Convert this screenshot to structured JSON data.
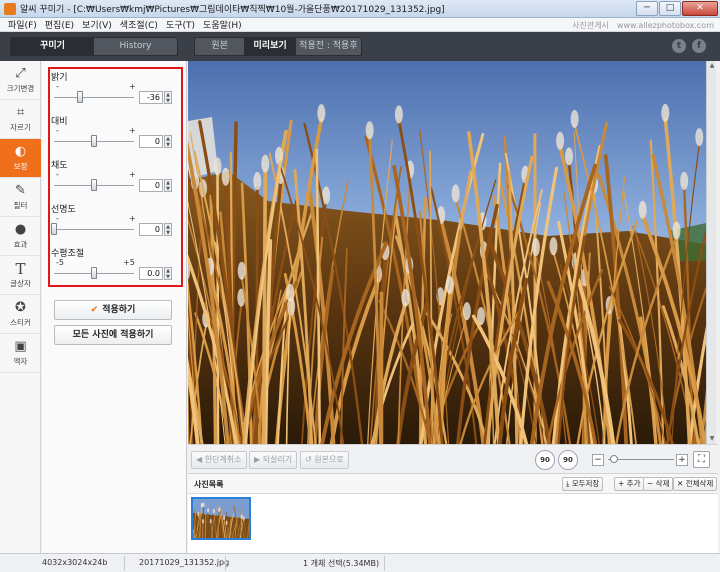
{
  "window": {
    "title": "알씨 꾸미기 - [C:₩Users₩kmj₩Pictures₩그림데이타₩직찍₩10월-가을단풍₩20171029_131352.jpg]",
    "btn_min": "─",
    "btn_max": "□",
    "btn_close": "✕"
  },
  "menu": {
    "items": [
      "파일(F)",
      "편집(E)",
      "보기(V)",
      "색조절(C)",
      "도구(T)",
      "도움말(H)"
    ],
    "right_1": "사진관게시",
    "right_2": "www.allezphotobox.com"
  },
  "topbar": {
    "tab_decorate": "꾸미기",
    "tab_history": "History",
    "view_original": "원본",
    "view_preview": "미리보기",
    "view_before_after": "적용전 : 적용후",
    "twitter": "t",
    "facebook": "f"
  },
  "rail": {
    "items": [
      {
        "label": "크기변경",
        "icon": "resize-icon",
        "glyph": "⤢"
      },
      {
        "label": "자르기",
        "icon": "crop-icon",
        "glyph": "⌗"
      },
      {
        "label": "보정",
        "icon": "correction-icon",
        "glyph": "◐"
      },
      {
        "label": "필터",
        "icon": "filter-wand-icon",
        "glyph": "✎"
      },
      {
        "label": "효과",
        "icon": "effect-drop-icon",
        "glyph": "●"
      },
      {
        "label": "글상자",
        "icon": "text-box-icon",
        "glyph": "T"
      },
      {
        "label": "스티커",
        "icon": "sticker-icon",
        "glyph": "✪"
      },
      {
        "label": "액자",
        "icon": "frame-icon",
        "glyph": "▣"
      }
    ],
    "active_index": 2
  },
  "adjust": {
    "brightness": {
      "label": "밝기",
      "min": "-",
      "max": "+",
      "value": "-36",
      "level": 0.32
    },
    "contrast": {
      "label": "대비",
      "min": "-",
      "max": "+",
      "value": "0",
      "level": 0.5
    },
    "saturation": {
      "label": "채도",
      "min": "-",
      "max": "+",
      "value": "0",
      "level": 0.5
    },
    "sharpness": {
      "label": "선명도",
      "min": "-",
      "max": "+",
      "value": "0",
      "level": 0.0
    },
    "horizon": {
      "label": "수평조절",
      "min": "-5",
      "max": "+5",
      "value": "0.0",
      "level": 0.5
    },
    "spin_up": "▲",
    "spin_down": "▼"
  },
  "buttons": {
    "apply_check": "✔",
    "apply": "적용하기",
    "apply_all": "모든 사진에 적용하기"
  },
  "bottom_toolbar": {
    "undo": "한단계취소",
    "redo": "되살리기",
    "original": "원본으로",
    "undo_icon": "◀",
    "redo_icon": "▶",
    "original_icon": "↺",
    "rotate_left": "90",
    "rotate_right": "90",
    "zoom_minus": "−",
    "zoom_plus": "+",
    "fit_icon": "⛶",
    "zoom_level": 0.03
  },
  "photo_list": {
    "title": "사진목록",
    "save_all": "모두저장",
    "add": "+ 추가",
    "delete": "− 삭제",
    "delete_all": "✕ 전체삭제",
    "save_icon": "⤓"
  },
  "status": {
    "dimensions": "4032x3024x24b",
    "filename": "20171029_131352.jpg",
    "selection": "1 개체 선택(5.34MB)"
  },
  "colors": {
    "accent": "#f06f1a",
    "highlight_box": "#e0161b",
    "toolbar_dark": "#3b3f47",
    "selection_blue": "#2b7fd6"
  }
}
